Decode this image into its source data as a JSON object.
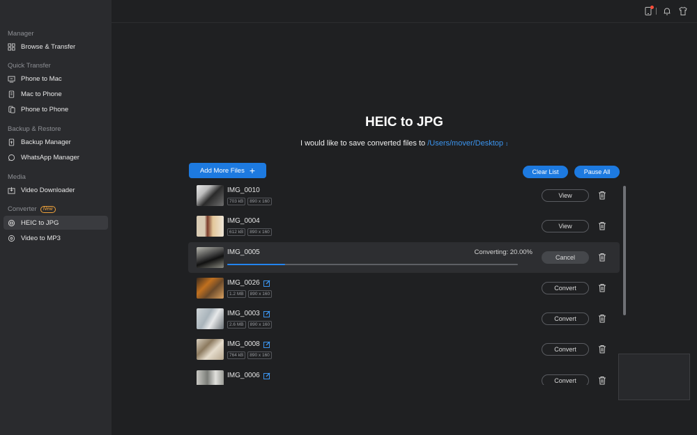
{
  "sidebar": {
    "sections": [
      {
        "title": "Manager",
        "items": [
          {
            "label": "Browse & Transfer",
            "icon": "grid-icon"
          }
        ]
      },
      {
        "title": "Quick Transfer",
        "items": [
          {
            "label": "Phone to Mac",
            "icon": "phone-to-mac-icon"
          },
          {
            "label": "Mac to Phone",
            "icon": "mac-to-phone-icon"
          },
          {
            "label": "Phone to Phone",
            "icon": "phone-to-phone-icon"
          }
        ]
      },
      {
        "title": "Backup & Restore",
        "items": [
          {
            "label": "Backup Manager",
            "icon": "backup-icon"
          },
          {
            "label": "WhatsApp Manager",
            "icon": "whatsapp-icon"
          }
        ]
      },
      {
        "title": "Media",
        "items": [
          {
            "label": "Video Downloader",
            "icon": "download-icon"
          }
        ]
      },
      {
        "title": "Converter",
        "badge": "New",
        "items": [
          {
            "label": "HEIC to JPG",
            "icon": "convert-image-icon",
            "active": true
          },
          {
            "label": "Video to MP3",
            "icon": "convert-audio-icon"
          }
        ]
      }
    ]
  },
  "main": {
    "title": "HEIC to JPG",
    "save_prefix": "I would like to save converted files to",
    "save_path": "/Users/mover/Desktop",
    "add_button": "Add More Files",
    "clear_button": "Clear List",
    "pause_button": "Pause All"
  },
  "files": [
    {
      "name": "IMG_0010",
      "size": "703 kB",
      "dims": "890 x 160",
      "action": "View"
    },
    {
      "name": "IMG_0004",
      "size": "612 kB",
      "dims": "890 x 160",
      "action": "View"
    },
    {
      "name": "IMG_0005",
      "status": "Converting: 20.00%",
      "progress": 0.2,
      "action": "Cancel"
    },
    {
      "name": "IMG_0026",
      "size": "1.2 MB",
      "dims": "890 x 160",
      "action": "Convert",
      "editable": true
    },
    {
      "name": "IMG_0003",
      "size": "2.6 MB",
      "dims": "890 x 160",
      "action": "Convert",
      "editable": true
    },
    {
      "name": "IMG_0008",
      "size": "764 kB",
      "dims": "890 x 160",
      "action": "Convert",
      "editable": true
    },
    {
      "name": "IMG_0006",
      "action": "Convert",
      "editable": true
    }
  ],
  "colors": {
    "accent": "#1d7ae0",
    "path": "#3b95f0",
    "notification": "#ff4d3a",
    "new_badge": "#f0a33b"
  }
}
